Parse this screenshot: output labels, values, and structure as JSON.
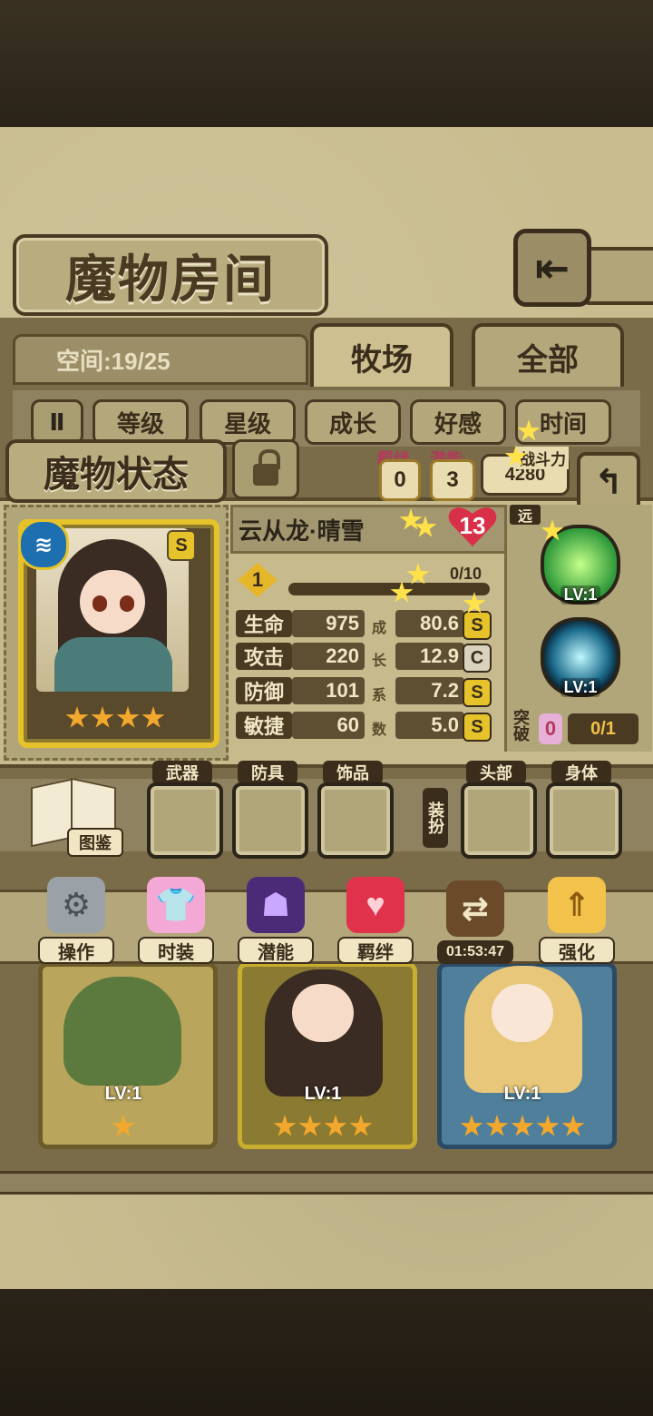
{
  "header": {
    "title": "魔物房间",
    "back_icon": "back-arrow-icon"
  },
  "room": {
    "space_text": "空间:19/25"
  },
  "tabs": [
    {
      "label": "牧场",
      "active": true
    },
    {
      "label": "全部",
      "active": false
    }
  ],
  "sort": {
    "pause_glyph": "Ⅱ",
    "buttons": [
      "等级",
      "星级",
      "成长",
      "好感",
      "时间"
    ]
  },
  "status": {
    "title": "魔物状态",
    "bond": {
      "label": "羁绊",
      "value": "0"
    },
    "potential": {
      "label": "潜能",
      "value": "3"
    },
    "power": {
      "label": "战斗力",
      "value": "4280"
    },
    "back_glyph": "↰"
  },
  "monster": {
    "name": "云从龙·晴雪",
    "affection": "13",
    "level": "1",
    "exp_text": "0/10",
    "exp_fraction": 0.0,
    "rank": "S",
    "element_icon": "water-element-icon",
    "stars": 4,
    "range_tag": "远"
  },
  "stats": [
    {
      "label": "生命",
      "value": "975",
      "growth_char": "成",
      "growth": "80.6",
      "grade": "S"
    },
    {
      "label": "攻击",
      "value": "220",
      "growth_char": "长",
      "growth": "12.9",
      "grade": "C"
    },
    {
      "label": "防御",
      "value": "101",
      "growth_char": "系",
      "growth": "7.2",
      "grade": "S"
    },
    {
      "label": "敏捷",
      "value": "60",
      "growth_char": "数",
      "growth": "5.0",
      "grade": "S"
    }
  ],
  "skills": [
    {
      "level": "LV:1"
    },
    {
      "level": "LV:1"
    }
  ],
  "breakthrough": {
    "label": "突破",
    "value": "0",
    "progress": "0/1"
  },
  "equipment": {
    "book_label": "图鉴",
    "slots": [
      "武器",
      "防具",
      "饰品",
      "头部",
      "身体"
    ],
    "pick_label": "装扮"
  },
  "actions": [
    {
      "label": "操作",
      "icon": "gear-icon"
    },
    {
      "label": "时装",
      "icon": "costume-icon"
    },
    {
      "label": "潜能",
      "icon": "demon-silhouette-icon"
    },
    {
      "label": "羁绊",
      "icon": "hearts-icon"
    },
    {
      "label": "01:53:47",
      "icon": "swap-arrows-icon"
    },
    {
      "label": "强化",
      "icon": "up-arrows-icon"
    }
  ],
  "monster_cards": [
    {
      "level": "LV:1",
      "stars": 1
    },
    {
      "level": "LV:1",
      "stars": 4
    },
    {
      "level": "LV:1",
      "stars": 5
    }
  ],
  "colors": {
    "gold_frame": "#e6c32a",
    "heart_red": "#d9304a",
    "paper": "#c9bd90"
  }
}
